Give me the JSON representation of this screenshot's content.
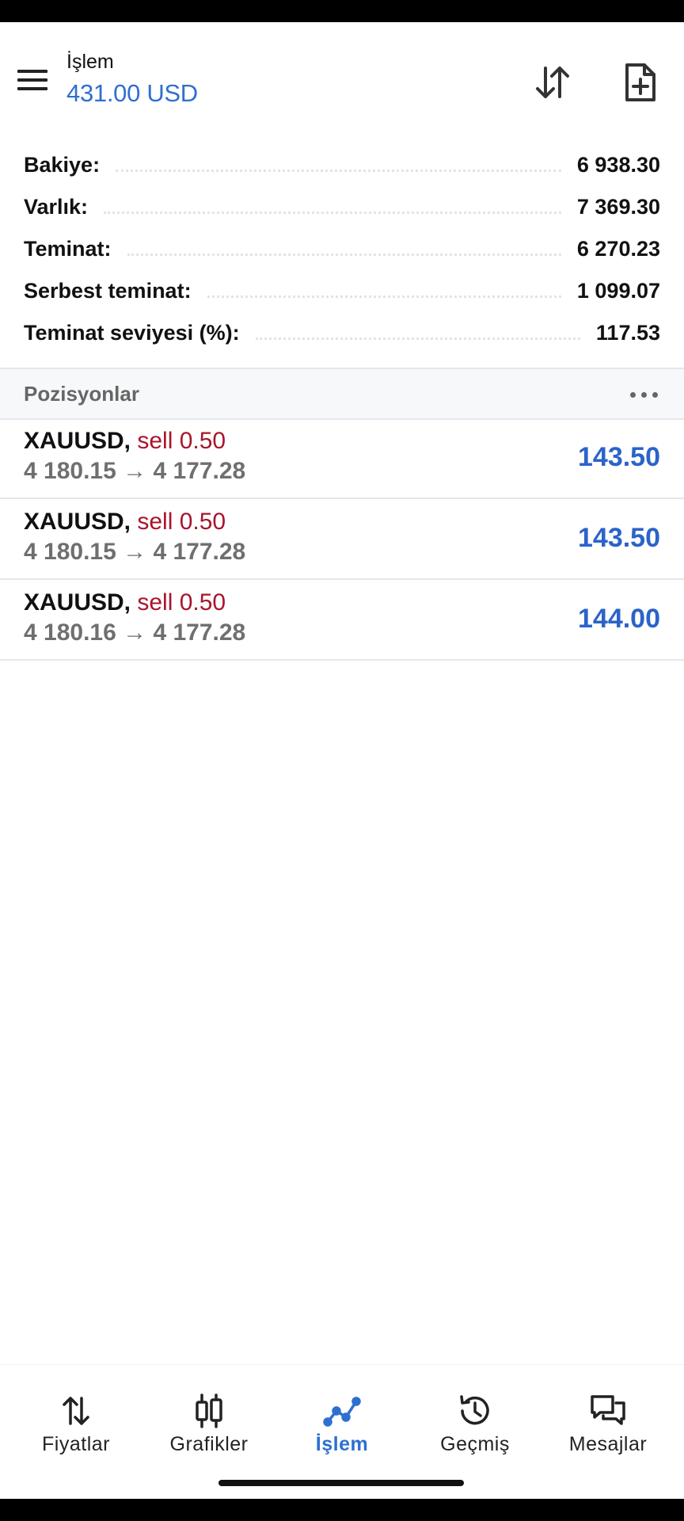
{
  "header": {
    "title": "İşlem",
    "balance": "431.00 USD",
    "icons": {
      "menu": "hamburger-menu-icon",
      "sort": "sort-arrows-icon",
      "new_order": "add-document-icon"
    }
  },
  "summary": [
    {
      "label": "Bakiye:",
      "value": "6 938.30"
    },
    {
      "label": "Varlık:",
      "value": "7 369.30"
    },
    {
      "label": "Teminat:",
      "value": "6 270.23"
    },
    {
      "label": "Serbest teminat:",
      "value": "1 099.07"
    },
    {
      "label": "Teminat seviyesi (%):",
      "value": "117.53"
    }
  ],
  "positions": {
    "title": "Pozisyonlar",
    "items": [
      {
        "symbol": "XAUUSD,",
        "side": "sell 0.50",
        "prices": "4 180.15 → 4 177.28",
        "profit": "143.50"
      },
      {
        "symbol": "XAUUSD,",
        "side": "sell 0.50",
        "prices": "4 180.15 → 4 177.28",
        "profit": "143.50"
      },
      {
        "symbol": "XAUUSD,",
        "side": "sell 0.50",
        "prices": "4 180.16 → 4 177.28",
        "profit": "144.00"
      }
    ]
  },
  "nav": {
    "items": [
      {
        "label": "Fiyatlar",
        "icon": "quotes-arrows-icon"
      },
      {
        "label": "Grafikler",
        "icon": "candlestick-chart-icon"
      },
      {
        "label": "İşlem",
        "icon": "trade-line-icon",
        "active": true
      },
      {
        "label": "Geçmiş",
        "icon": "history-clock-icon"
      },
      {
        "label": "Mesajlar",
        "icon": "messages-icon"
      }
    ]
  },
  "colors": {
    "accent": "#2f6fd0",
    "sell": "#a8152b",
    "profit": "#2b63c9",
    "muted": "#6f6f6f"
  }
}
